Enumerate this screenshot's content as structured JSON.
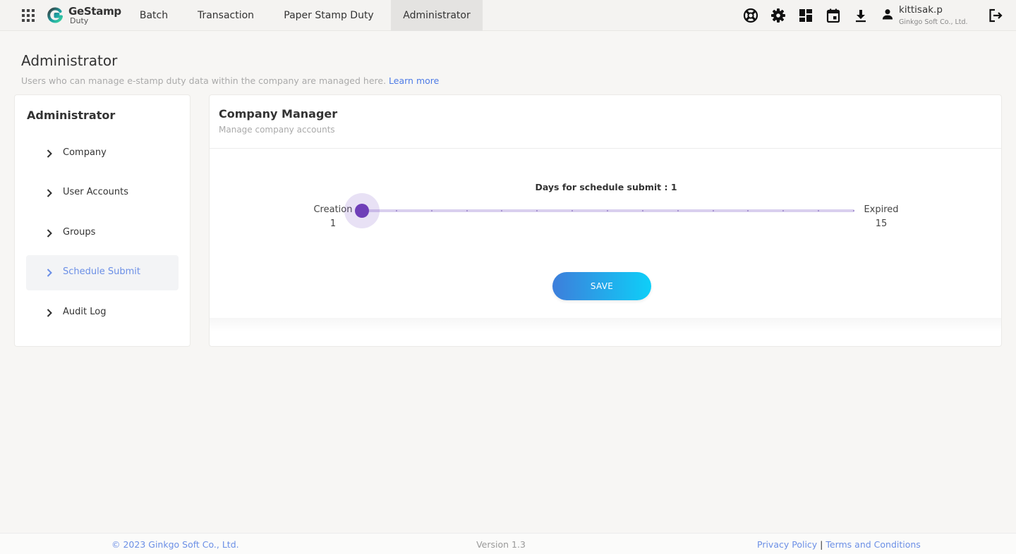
{
  "app": {
    "logo_title": "GeStamp",
    "logo_subtitle": "Duty",
    "brand_color": "#1c9fa3"
  },
  "nav": {
    "tabs": [
      {
        "label": "Batch",
        "active": false
      },
      {
        "label": "Transaction",
        "active": false
      },
      {
        "label": "Paper Stamp Duty",
        "active": false
      },
      {
        "label": "Administrator",
        "active": true
      }
    ],
    "icons": [
      "support-icon",
      "settings-gear-icon",
      "dashboard-icon",
      "calendar-icon",
      "download-icon",
      "user-icon",
      "logout-icon"
    ]
  },
  "user": {
    "name": "kittisak.p",
    "company": "Ginkgo Soft Co., Ltd."
  },
  "page": {
    "title": "Administrator",
    "description": "Users who can manage e-stamp duty data within the company are managed here.",
    "learn_more": "Learn more"
  },
  "sidebar": {
    "title": "Administrator",
    "items": [
      {
        "label": "Company",
        "active": false
      },
      {
        "label": "User Accounts",
        "active": false
      },
      {
        "label": "Groups",
        "active": false
      },
      {
        "label": "Schedule Submit",
        "active": true
      },
      {
        "label": "Audit Log",
        "active": false
      }
    ]
  },
  "card": {
    "title": "Company Manager",
    "subtitle": "Manage company accounts"
  },
  "schedule": {
    "label": "Days for schedule submit : 1",
    "min_label": "Creation",
    "min_value": "1",
    "max_label": "Expired",
    "max_value": "15",
    "current_value": 1,
    "accent_color": "#6f3fb8"
  },
  "actions": {
    "save_label": "SAVE"
  },
  "footer": {
    "copyright": "© 2023 Ginkgo Soft Co., Ltd.",
    "version": "Version 1.3",
    "privacy": "Privacy Policy",
    "separator": "|",
    "terms": "Terms and Conditions"
  }
}
